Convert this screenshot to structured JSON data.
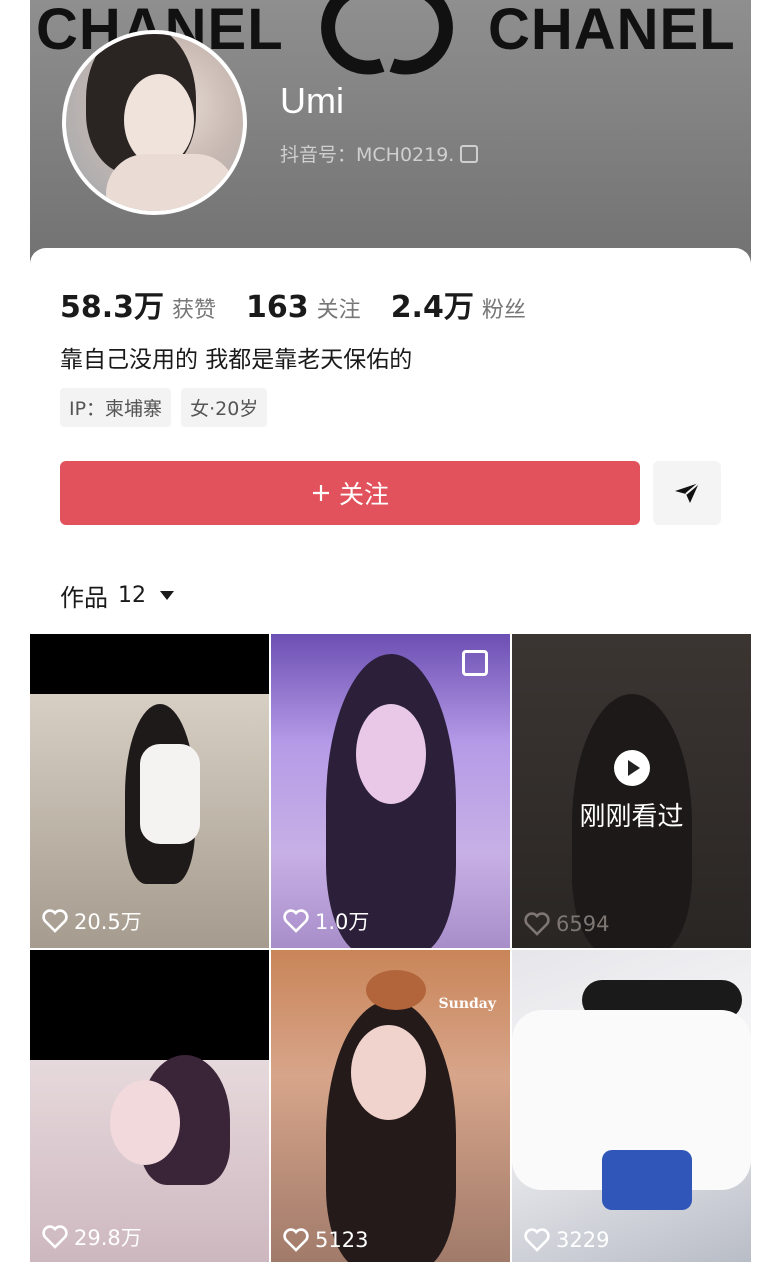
{
  "cover": {
    "brand_left": "CHANEL",
    "brand_right": "CHANEL"
  },
  "profile": {
    "username": "Umi",
    "douyin_id": "抖音号：MCH0219.",
    "stats": [
      {
        "value": "58.3万",
        "label": "获赞"
      },
      {
        "value": "163",
        "label": "关注"
      },
      {
        "value": "2.4万",
        "label": "粉丝"
      }
    ],
    "bio": "靠自己没用的 我都是靠老天保佑的",
    "tags": [
      "IP：柬埔寨",
      "女·20岁"
    ]
  },
  "actions": {
    "follow_label": "关注",
    "follow_icon": "plus-icon",
    "share_icon": "send-icon"
  },
  "works": {
    "label": "作品",
    "count": "12"
  },
  "videos": [
    {
      "likes": "20.5万"
    },
    {
      "likes": "1.0万"
    },
    {
      "likes": "6594",
      "overlay": "刚刚看过"
    },
    {
      "likes": "29.8万"
    },
    {
      "likes": "5123",
      "sticker_text": "Sunday"
    },
    {
      "likes": "3229"
    }
  ],
  "colors": {
    "follow_button": "#e2525c",
    "text_primary": "#1a1a1a",
    "text_secondary": "#777777"
  }
}
